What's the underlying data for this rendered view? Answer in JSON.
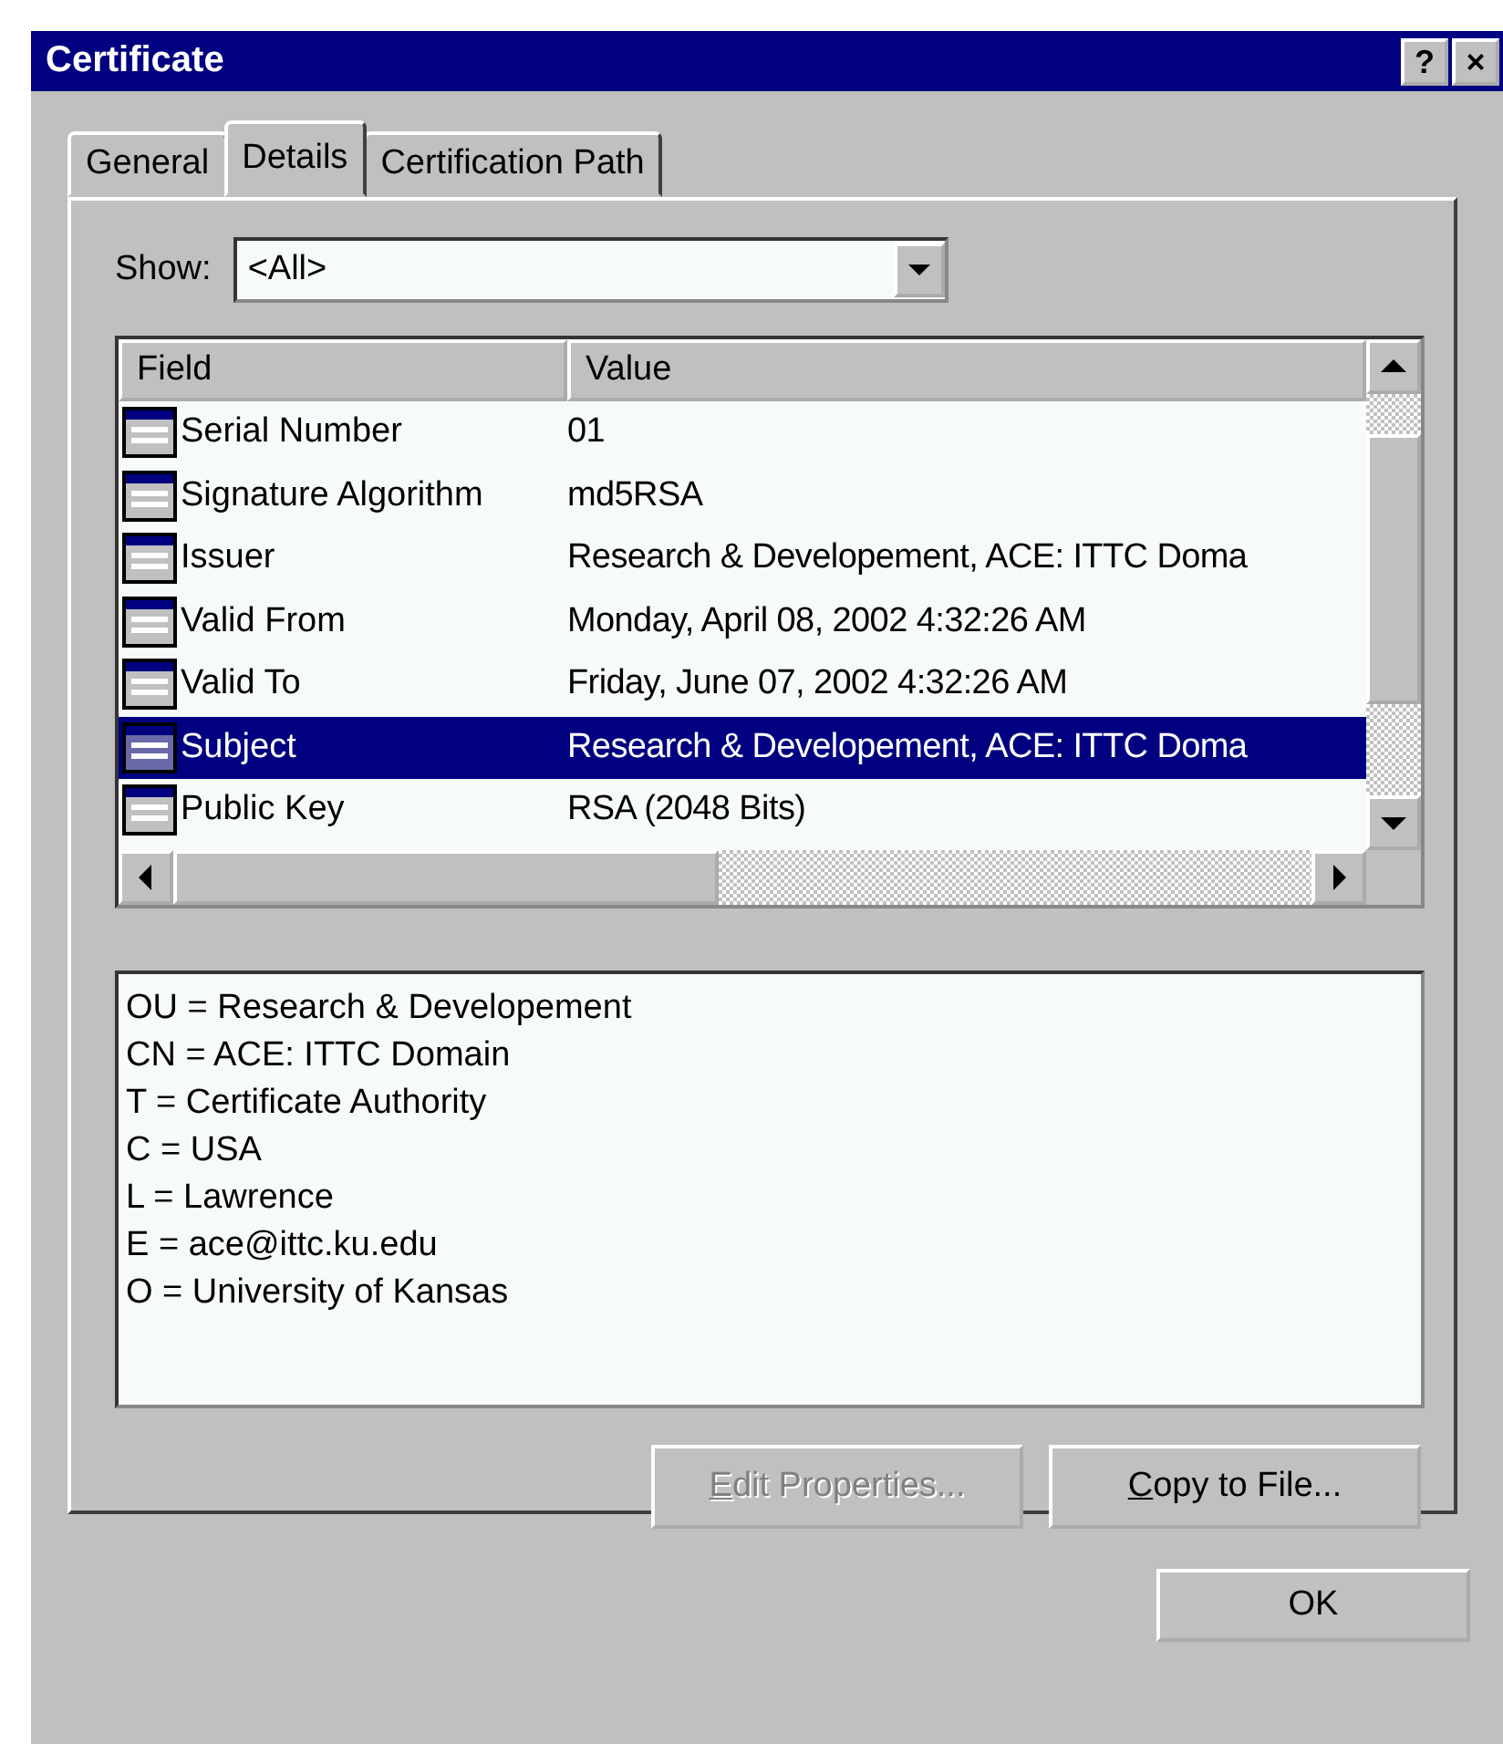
{
  "window": {
    "title": "Certificate",
    "help_button": "?",
    "close_button": "×"
  },
  "tabs": [
    {
      "label": "General",
      "selected": false
    },
    {
      "label": "Details",
      "selected": true
    },
    {
      "label": "Certification Path",
      "selected": false
    }
  ],
  "show": {
    "label": "Show:",
    "value": "<All>"
  },
  "table": {
    "columns": [
      "Field",
      "Value"
    ],
    "rows": [
      {
        "field": "Serial Number",
        "value": "01",
        "selected": false
      },
      {
        "field": "Signature Algorithm",
        "value": "md5RSA",
        "selected": false
      },
      {
        "field": "Issuer",
        "value": "Research & Developement, ACE: ITTC Doma",
        "selected": false
      },
      {
        "field": "Valid From",
        "value": "Monday, April 08, 2002 4:32:26 AM",
        "selected": false
      },
      {
        "field": "Valid To",
        "value": "Friday, June 07, 2002 4:32:26 AM",
        "selected": false
      },
      {
        "field": "Subject",
        "value": "Research & Developement, ACE: ITTC Doma",
        "selected": true
      },
      {
        "field": "Public Key",
        "value": "RSA (2048 Bits)",
        "selected": false
      }
    ]
  },
  "detail_lines": [
    "OU = Research & Developement",
    "CN = ACE: ITTC Domain",
    "T = Certificate Authority",
    "C = USA",
    "L = Lawrence",
    "E = ace@ittc.ku.edu",
    "O = University of Kansas"
  ],
  "buttons": [
    {
      "label": "Edit Properties...",
      "disabled": true
    },
    {
      "label": "Copy to File...",
      "disabled": false
    }
  ],
  "ok_button": "OK"
}
